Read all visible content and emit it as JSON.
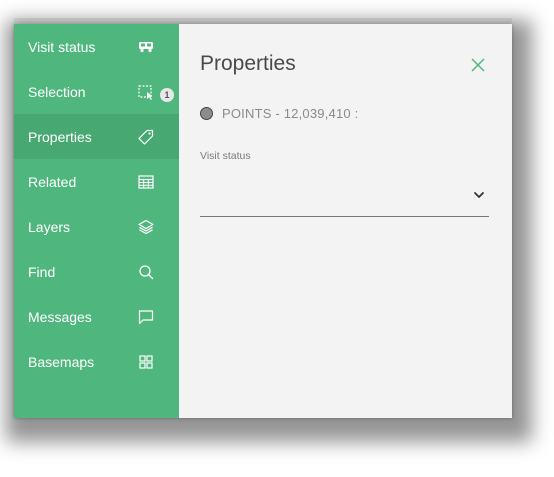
{
  "sidebar": {
    "items": [
      {
        "label": "Visit status",
        "icon": "truck-icon"
      },
      {
        "label": "Selection",
        "icon": "selection-icon"
      },
      {
        "label": "Properties",
        "icon": "tag-icon"
      },
      {
        "label": "Related",
        "icon": "table-icon"
      },
      {
        "label": "Layers",
        "icon": "layers-icon"
      },
      {
        "label": "Find",
        "icon": "search-icon"
      },
      {
        "label": "Messages",
        "icon": "message-icon"
      },
      {
        "label": "Basemaps",
        "icon": "grid-icon"
      }
    ],
    "active_item": "Properties",
    "selection_badge": "1"
  },
  "panel": {
    "title": "Properties",
    "feature_label": "POINTS - 12,039,410 :",
    "field_label": "Visit status",
    "field_value": ""
  },
  "colors": {
    "sidebar_bg": "#4fb77e",
    "sidebar_active_bg": "#47a872",
    "close_icon": "#4fb77e",
    "panel_bg": "#f3f3f3"
  }
}
